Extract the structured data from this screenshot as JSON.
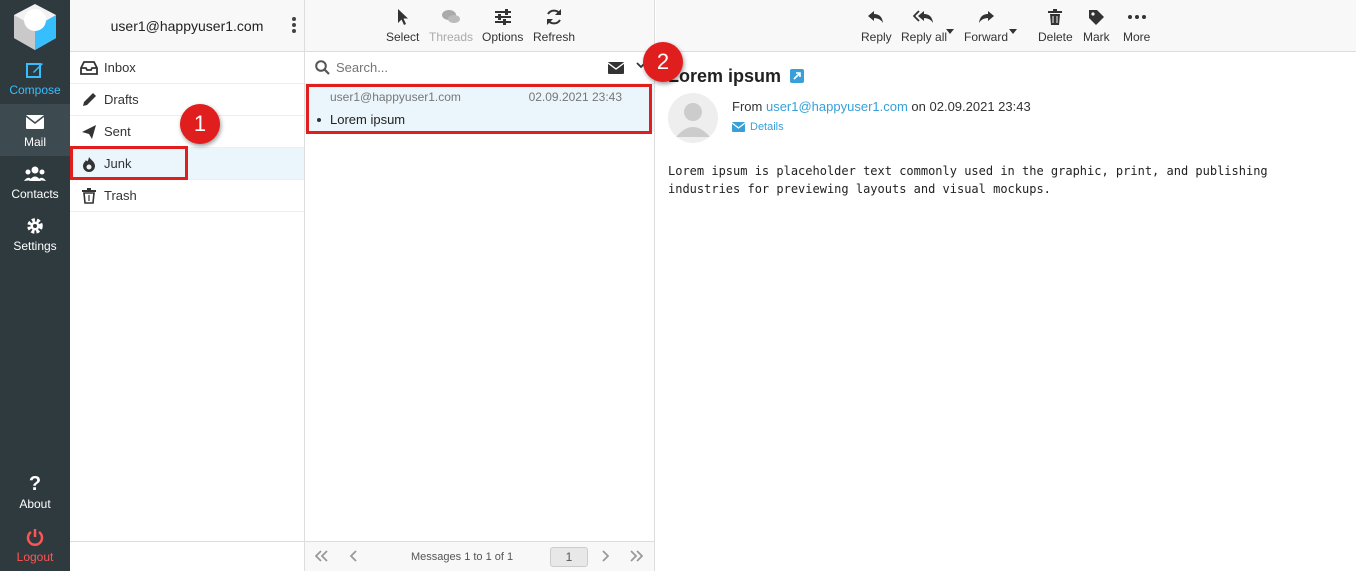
{
  "rail": {
    "compose": "Compose",
    "mail": "Mail",
    "contacts": "Contacts",
    "settings": "Settings",
    "about": "About",
    "logout": "Logout"
  },
  "account": "user1@happyuser1.com",
  "folders": [
    {
      "label": "Inbox",
      "icon": "inbox-icon"
    },
    {
      "label": "Drafts",
      "icon": "pencil-icon"
    },
    {
      "label": "Sent",
      "icon": "paper-plane-icon"
    },
    {
      "label": "Junk",
      "icon": "fire-icon",
      "selected": true
    },
    {
      "label": "Trash",
      "icon": "trash-icon"
    }
  ],
  "list_toolbar": {
    "select": "Select",
    "threads": "Threads",
    "options": "Options",
    "refresh": "Refresh"
  },
  "search": {
    "placeholder": "Search..."
  },
  "message": {
    "from": "user1@happyuser1.com",
    "date": "02.09.2021 23:43",
    "subject": "Lorem ipsum"
  },
  "pager": {
    "summary": "Messages 1 to 1 of 1",
    "page": "1"
  },
  "reader_toolbar": {
    "reply": "Reply",
    "reply_all": "Reply all",
    "forward": "Forward",
    "delete": "Delete",
    "mark": "Mark",
    "more": "More"
  },
  "reader": {
    "title": "Lorem ipsum",
    "from_prefix": "From",
    "from_addr": "user1@happyuser1.com",
    "on_text": "on 02.09.2021 23:43",
    "details": "Details",
    "body": "Lorem ipsum is placeholder text commonly used in the graphic, print, and publishing industries for previewing layouts and visual mockups."
  },
  "annotations": {
    "one": "1",
    "two": "2"
  },
  "colors": {
    "accent": "#37beff",
    "highlight": "#e01e1e",
    "rail": "#2f3a3f",
    "selected": "#ebf6fc"
  }
}
